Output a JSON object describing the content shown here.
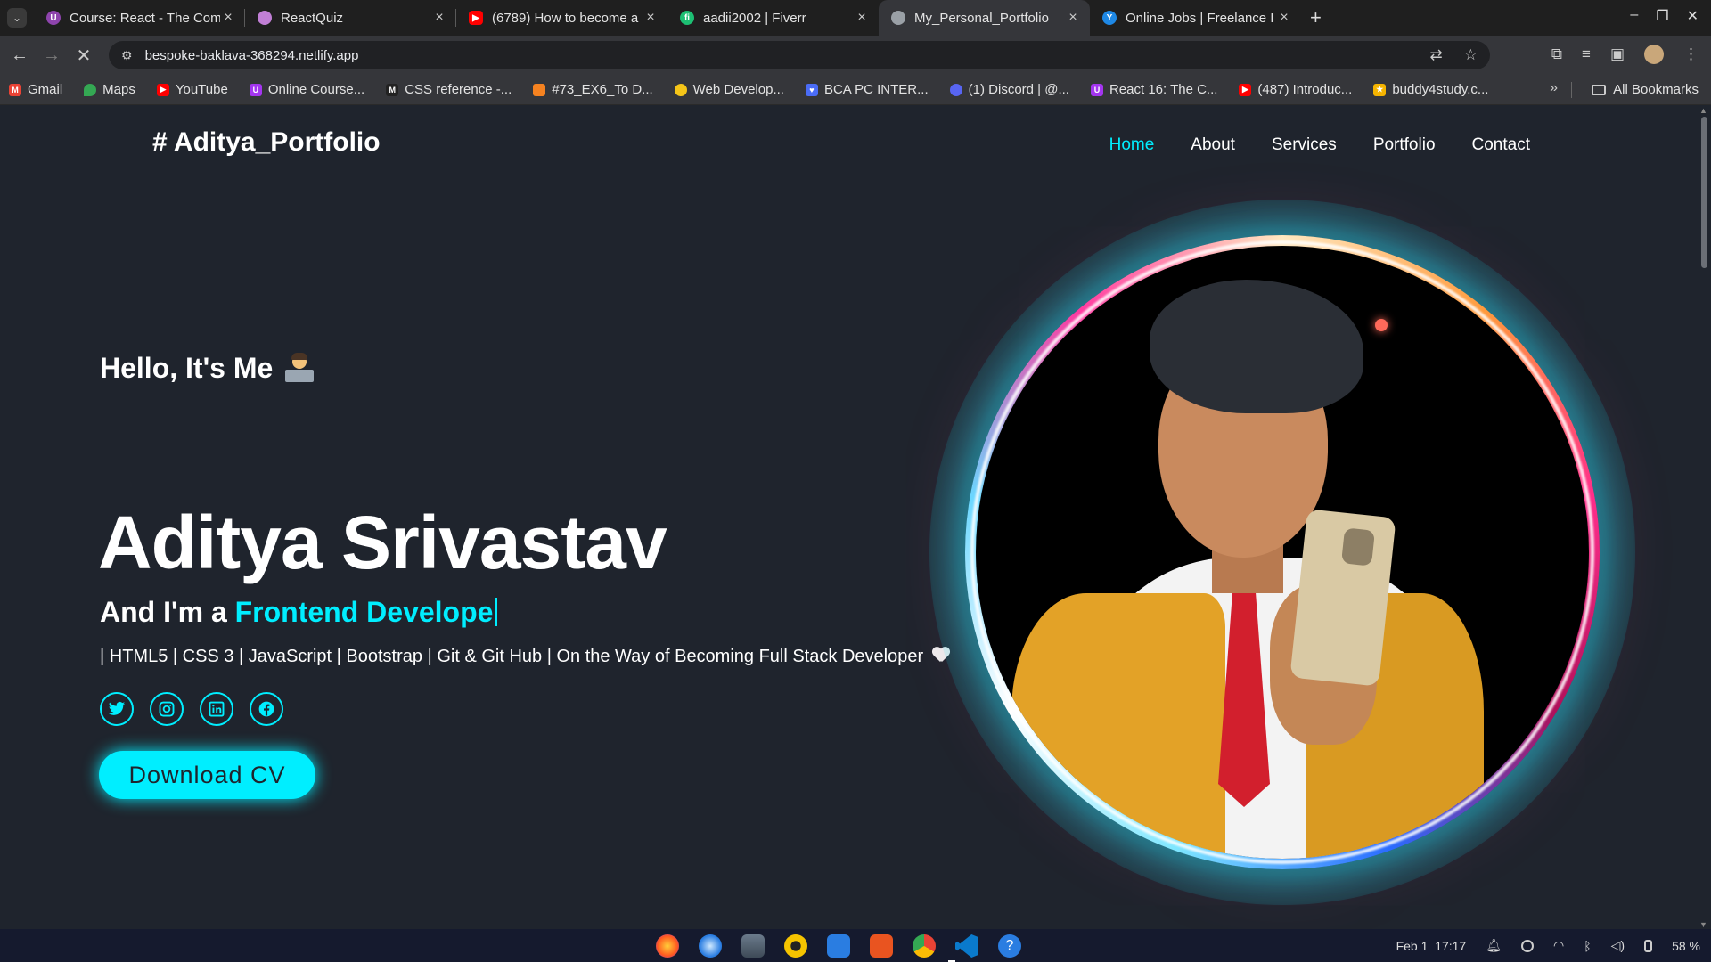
{
  "browser": {
    "tabs": [
      {
        "title": "Course: React - The Comp",
        "favicon_color": "#8e44ad",
        "active": false
      },
      {
        "title": "ReactQuiz",
        "favicon_color": "#c17fd6",
        "active": false
      },
      {
        "title": "(6789) How to become a",
        "favicon_color": "#ff0000",
        "active": false
      },
      {
        "title": "aadii2002 | Fiverr",
        "favicon_color": "#1dbf73",
        "active": false
      },
      {
        "title": "My_Personal_Portfolio",
        "favicon_color": "#9aa0a6",
        "active": true
      },
      {
        "title": "Online Jobs | Freelance I",
        "favicon_color": "#1e88e5",
        "active": false
      }
    ],
    "url": "bespoke-baklava-368294.netlify.app",
    "bookmarks": [
      {
        "label": "Gmail",
        "color": "#ea4335"
      },
      {
        "label": "Maps",
        "color": "#34a853"
      },
      {
        "label": "YouTube",
        "color": "#ff0000"
      },
      {
        "label": "Online Course...",
        "color": "#a435f0"
      },
      {
        "label": "CSS reference -...",
        "color": "#222222"
      },
      {
        "label": "#73_EX6_To D...",
        "color": "#f58220"
      },
      {
        "label": "Web Develop...",
        "color": "#f5c518"
      },
      {
        "label": "BCA PC INTER...",
        "color": "#4a6cf7"
      },
      {
        "label": "(1) Discord | @...",
        "color": "#5865f2"
      },
      {
        "label": "React 16: The C...",
        "color": "#a435f0"
      },
      {
        "label": "(487) Introduc...",
        "color": "#ff0000"
      },
      {
        "label": "buddy4study.c...",
        "color": "#f5b400"
      }
    ],
    "all_bookmarks": "All Bookmarks"
  },
  "site": {
    "logo": "# Aditya_Portfolio",
    "nav": [
      "Home",
      "About",
      "Services",
      "Portfolio",
      "Contact"
    ],
    "active_nav": "Home",
    "accent_color": "#00eeff",
    "background_color": "#1f242d",
    "hello": "Hello, It's Me",
    "name": "Aditya Srivastav",
    "role_prefix": "And I'm a",
    "role_highlight": "Frontend Develope",
    "skills": "| HTML5 | CSS 3 | JavaScript | Bootstrap | Git & Git Hub | On the Way of Becoming Full Stack Developer",
    "socials": [
      "twitter-icon",
      "instagram-icon",
      "linkedin-icon",
      "facebook-icon"
    ],
    "cv_button": "Download CV"
  },
  "taskbar": {
    "date": "Feb 1",
    "time": "17:17",
    "battery": "58 %"
  }
}
